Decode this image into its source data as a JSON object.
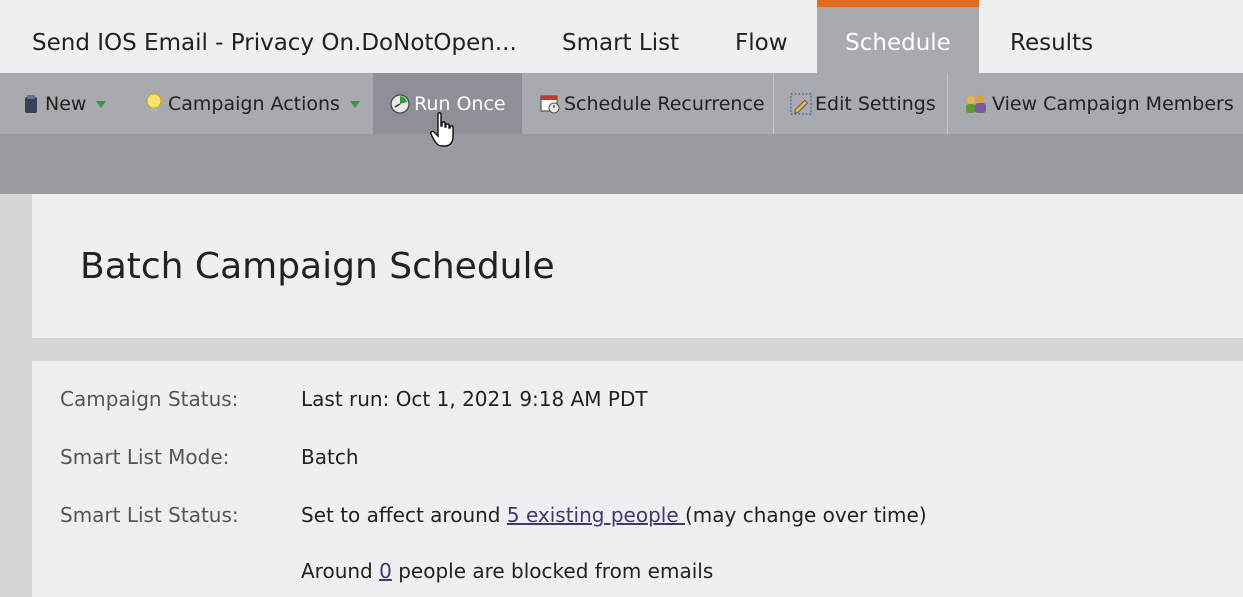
{
  "tabs": {
    "title": "Send IOS Email - Privacy On.DoNotOpen...",
    "smart_list": "Smart List",
    "flow": "Flow",
    "schedule": "Schedule",
    "results": "Results"
  },
  "toolbar": {
    "new_label": "New",
    "campaign_actions_label": "Campaign Actions",
    "run_once_label": "Run Once",
    "schedule_recurrence_label": "Schedule Recurrence",
    "edit_settings_label": "Edit Settings",
    "view_members_label": "View Campaign Members"
  },
  "panel": {
    "title": "Batch Campaign Schedule"
  },
  "details": {
    "campaign_status_label": "Campaign Status:",
    "campaign_status_value": "Last run: Oct 1, 2021 9:18 AM PDT",
    "smart_list_mode_label": "Smart List Mode:",
    "smart_list_mode_value": "Batch",
    "smart_list_status_label": "Smart List Status:",
    "affect_prefix": "Set to affect around ",
    "affect_link": "5 existing people ",
    "affect_suffix": "(may change over time)",
    "blocked_prefix": "Around ",
    "blocked_link": "0",
    "blocked_suffix": " people are blocked from emails"
  },
  "colors": {
    "active_tab_accent": "#e06c1f",
    "active_tab_bg": "#a9a9b0",
    "link": "#3c3c6e"
  },
  "icons": [
    "new-icon",
    "lightbulb-icon",
    "run-once-icon",
    "schedule-recurrence-icon",
    "edit-settings-icon",
    "view-members-icon",
    "hand-cursor-icon"
  ]
}
